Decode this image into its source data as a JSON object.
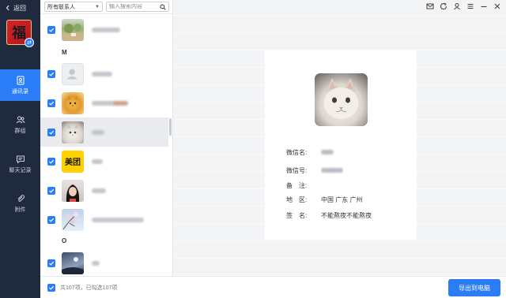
{
  "app": {
    "back_label": "返回",
    "avatar_char": "福",
    "avatar_badge": "⇄"
  },
  "nav": [
    {
      "label": "通讯录",
      "icon": "address-book-icon",
      "active": true
    },
    {
      "label": "群组",
      "icon": "group-icon",
      "active": false
    },
    {
      "label": "聊天记录",
      "icon": "chat-history-icon",
      "active": false
    },
    {
      "label": "附件",
      "icon": "attachment-icon",
      "active": false
    }
  ],
  "filter": {
    "selected": "所有联系人",
    "search_placeholder": "输入搜索内容"
  },
  "sections": [
    "M",
    "O"
  ],
  "contacts": [
    {
      "thumb": "landscape",
      "checked": true,
      "selected": false
    },
    {
      "thumb": "default-avatar",
      "checked": true,
      "selected": false
    },
    {
      "thumb": "cat-orange",
      "checked": true,
      "selected": false
    },
    {
      "thumb": "cat-white",
      "checked": true,
      "selected": true
    },
    {
      "thumb": "meituan",
      "thumb_text": "美团",
      "checked": true,
      "selected": false
    },
    {
      "thumb": "portrait",
      "checked": true,
      "selected": false
    },
    {
      "thumb": "blossom",
      "checked": true,
      "selected": false
    },
    {
      "thumb": "night",
      "checked": true,
      "selected": false
    }
  ],
  "footer": {
    "summary": "共107项，已勾选107项",
    "export_label": "导出到电脑"
  },
  "detail": {
    "fields": [
      {
        "label": "微信名:",
        "value": ""
      },
      {
        "label": "微信号:",
        "value": ""
      },
      {
        "label": "备　注:",
        "value": ""
      },
      {
        "label": "地　区:",
        "value": "中国 广东 广州"
      },
      {
        "label": "签　名:",
        "value": "不能熬夜不能熬夜"
      }
    ]
  },
  "colors": {
    "accent": "#2a7df6",
    "sidebar": "#1f2a3f"
  }
}
